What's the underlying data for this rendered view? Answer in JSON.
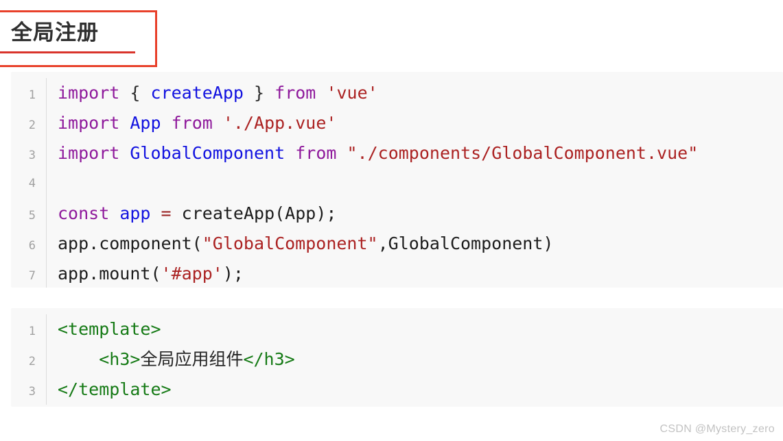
{
  "heading": {
    "title": "全局注册",
    "annotation_color": "#e8402a",
    "underline_color": "#d9342b"
  },
  "code_blocks": [
    {
      "name": "main-js",
      "language": "javascript",
      "background": "#f8f8f8",
      "lines": [
        {
          "number": "1",
          "tokens": [
            {
              "text": "import",
              "type": "keyword"
            },
            {
              "text": " ",
              "type": "plain"
            },
            {
              "text": "{",
              "type": "punct"
            },
            {
              "text": " ",
              "type": "plain"
            },
            {
              "text": "createApp",
              "type": "identifier"
            },
            {
              "text": " ",
              "type": "plain"
            },
            {
              "text": "}",
              "type": "punct"
            },
            {
              "text": " ",
              "type": "plain"
            },
            {
              "text": "from",
              "type": "keyword"
            },
            {
              "text": " ",
              "type": "plain"
            },
            {
              "text": "'vue'",
              "type": "string"
            }
          ]
        },
        {
          "number": "2",
          "tokens": [
            {
              "text": "import",
              "type": "keyword"
            },
            {
              "text": " ",
              "type": "plain"
            },
            {
              "text": "App",
              "type": "identifier"
            },
            {
              "text": " ",
              "type": "plain"
            },
            {
              "text": "from",
              "type": "keyword"
            },
            {
              "text": " ",
              "type": "plain"
            },
            {
              "text": "'./App.vue'",
              "type": "string"
            }
          ]
        },
        {
          "number": "3",
          "tokens": [
            {
              "text": "import",
              "type": "keyword"
            },
            {
              "text": " ",
              "type": "plain"
            },
            {
              "text": "GlobalComponent",
              "type": "identifier"
            },
            {
              "text": " ",
              "type": "plain"
            },
            {
              "text": "from",
              "type": "keyword"
            },
            {
              "text": " ",
              "type": "plain"
            },
            {
              "text": "\"./components/GlobalComponent.vue\"",
              "type": "string"
            }
          ]
        },
        {
          "number": "4",
          "tokens": []
        },
        {
          "number": "5",
          "tokens": [
            {
              "text": "const",
              "type": "keyword"
            },
            {
              "text": " ",
              "type": "plain"
            },
            {
              "text": "app",
              "type": "identifier"
            },
            {
              "text": " ",
              "type": "plain"
            },
            {
              "text": "=",
              "type": "operator"
            },
            {
              "text": " ",
              "type": "plain"
            },
            {
              "text": "createApp(App);",
              "type": "plain"
            }
          ]
        },
        {
          "number": "6",
          "tokens": [
            {
              "text": "app.component(",
              "type": "plain"
            },
            {
              "text": "\"GlobalComponent\"",
              "type": "string"
            },
            {
              "text": ",GlobalComponent)",
              "type": "plain"
            }
          ]
        },
        {
          "number": "7",
          "tokens": [
            {
              "text": "app.mount(",
              "type": "plain"
            },
            {
              "text": "'#app'",
              "type": "string"
            },
            {
              "text": ");",
              "type": "plain"
            }
          ]
        }
      ]
    },
    {
      "name": "global-component-vue",
      "language": "html",
      "background": "#f8f8f8",
      "lines": [
        {
          "number": "1",
          "tokens": [
            {
              "text": "<template>",
              "type": "tag"
            }
          ]
        },
        {
          "number": "2",
          "tokens": [
            {
              "text": "    ",
              "type": "plain"
            },
            {
              "text": "<h3>",
              "type": "tag"
            },
            {
              "text": "全局应用组件",
              "type": "chinese"
            },
            {
              "text": "</h3>",
              "type": "tag"
            }
          ]
        },
        {
          "number": "3",
          "tokens": [
            {
              "text": "</template>",
              "type": "tag"
            }
          ]
        }
      ]
    }
  ],
  "watermark": {
    "text": "CSDN @Mystery_zero"
  }
}
